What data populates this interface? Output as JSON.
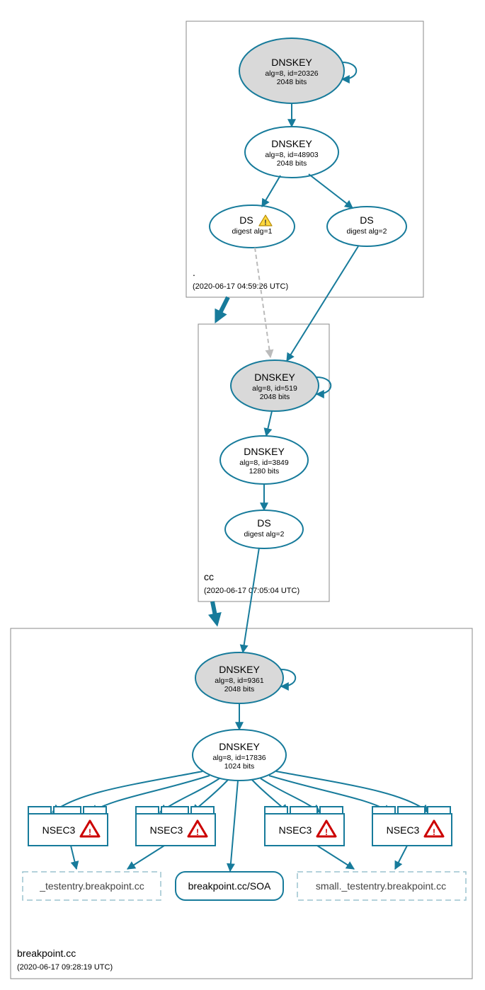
{
  "zones": {
    "root": {
      "name": ".",
      "timestamp": "(2020-06-17 04:59:26 UTC)"
    },
    "cc": {
      "name": "cc",
      "timestamp": "(2020-06-17 07:05:04 UTC)"
    },
    "bp": {
      "name": "breakpoint.cc",
      "timestamp": "(2020-06-17 09:28:19 UTC)"
    }
  },
  "nodes": {
    "root_ksk": {
      "title": "DNSKEY",
      "l1": "alg=8, id=20326",
      "l2": "2048 bits"
    },
    "root_zsk": {
      "title": "DNSKEY",
      "l1": "alg=8, id=48903",
      "l2": "2048 bits"
    },
    "root_ds1": {
      "title": "DS",
      "l1": "digest alg=1"
    },
    "root_ds2": {
      "title": "DS",
      "l1": "digest alg=2"
    },
    "cc_ksk": {
      "title": "DNSKEY",
      "l1": "alg=8, id=519",
      "l2": "2048 bits"
    },
    "cc_zsk": {
      "title": "DNSKEY",
      "l1": "alg=8, id=3849",
      "l2": "1280 bits"
    },
    "cc_ds": {
      "title": "DS",
      "l1": "digest alg=2"
    },
    "bp_ksk": {
      "title": "DNSKEY",
      "l1": "alg=8, id=9361",
      "l2": "2048 bits"
    },
    "bp_zsk": {
      "title": "DNSKEY",
      "l1": "alg=8, id=17836",
      "l2": "1024 bits"
    },
    "nsec3": {
      "title": "NSEC3"
    },
    "soa": {
      "title": "breakpoint.cc/SOA"
    },
    "nodata1": {
      "title": "_testentry.breakpoint.cc"
    },
    "nodata2": {
      "title": "small._testentry.breakpoint.cc"
    }
  }
}
